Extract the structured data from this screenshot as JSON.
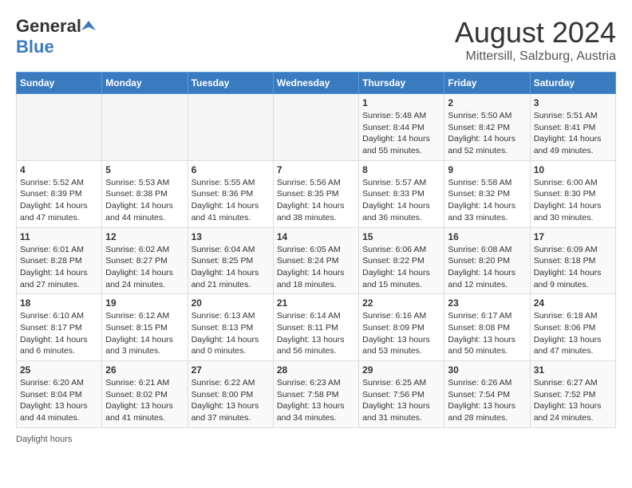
{
  "header": {
    "logo_general": "General",
    "logo_blue": "Blue",
    "month": "August 2024",
    "location": "Mittersill, Salzburg, Austria"
  },
  "weekdays": [
    "Sunday",
    "Monday",
    "Tuesday",
    "Wednesday",
    "Thursday",
    "Friday",
    "Saturday"
  ],
  "footer": {
    "note": "Daylight hours"
  },
  "weeks": [
    [
      {
        "day": "",
        "info": ""
      },
      {
        "day": "",
        "info": ""
      },
      {
        "day": "",
        "info": ""
      },
      {
        "day": "",
        "info": ""
      },
      {
        "day": "1",
        "info": "Sunrise: 5:48 AM\nSunset: 8:44 PM\nDaylight: 14 hours\nand 55 minutes."
      },
      {
        "day": "2",
        "info": "Sunrise: 5:50 AM\nSunset: 8:42 PM\nDaylight: 14 hours\nand 52 minutes."
      },
      {
        "day": "3",
        "info": "Sunrise: 5:51 AM\nSunset: 8:41 PM\nDaylight: 14 hours\nand 49 minutes."
      }
    ],
    [
      {
        "day": "4",
        "info": "Sunrise: 5:52 AM\nSunset: 8:39 PM\nDaylight: 14 hours\nand 47 minutes."
      },
      {
        "day": "5",
        "info": "Sunrise: 5:53 AM\nSunset: 8:38 PM\nDaylight: 14 hours\nand 44 minutes."
      },
      {
        "day": "6",
        "info": "Sunrise: 5:55 AM\nSunset: 8:36 PM\nDaylight: 14 hours\nand 41 minutes."
      },
      {
        "day": "7",
        "info": "Sunrise: 5:56 AM\nSunset: 8:35 PM\nDaylight: 14 hours\nand 38 minutes."
      },
      {
        "day": "8",
        "info": "Sunrise: 5:57 AM\nSunset: 8:33 PM\nDaylight: 14 hours\nand 36 minutes."
      },
      {
        "day": "9",
        "info": "Sunrise: 5:58 AM\nSunset: 8:32 PM\nDaylight: 14 hours\nand 33 minutes."
      },
      {
        "day": "10",
        "info": "Sunrise: 6:00 AM\nSunset: 8:30 PM\nDaylight: 14 hours\nand 30 minutes."
      }
    ],
    [
      {
        "day": "11",
        "info": "Sunrise: 6:01 AM\nSunset: 8:28 PM\nDaylight: 14 hours\nand 27 minutes."
      },
      {
        "day": "12",
        "info": "Sunrise: 6:02 AM\nSunset: 8:27 PM\nDaylight: 14 hours\nand 24 minutes."
      },
      {
        "day": "13",
        "info": "Sunrise: 6:04 AM\nSunset: 8:25 PM\nDaylight: 14 hours\nand 21 minutes."
      },
      {
        "day": "14",
        "info": "Sunrise: 6:05 AM\nSunset: 8:24 PM\nDaylight: 14 hours\nand 18 minutes."
      },
      {
        "day": "15",
        "info": "Sunrise: 6:06 AM\nSunset: 8:22 PM\nDaylight: 14 hours\nand 15 minutes."
      },
      {
        "day": "16",
        "info": "Sunrise: 6:08 AM\nSunset: 8:20 PM\nDaylight: 14 hours\nand 12 minutes."
      },
      {
        "day": "17",
        "info": "Sunrise: 6:09 AM\nSunset: 8:18 PM\nDaylight: 14 hours\nand 9 minutes."
      }
    ],
    [
      {
        "day": "18",
        "info": "Sunrise: 6:10 AM\nSunset: 8:17 PM\nDaylight: 14 hours\nand 6 minutes."
      },
      {
        "day": "19",
        "info": "Sunrise: 6:12 AM\nSunset: 8:15 PM\nDaylight: 14 hours\nand 3 minutes."
      },
      {
        "day": "20",
        "info": "Sunrise: 6:13 AM\nSunset: 8:13 PM\nDaylight: 14 hours\nand 0 minutes."
      },
      {
        "day": "21",
        "info": "Sunrise: 6:14 AM\nSunset: 8:11 PM\nDaylight: 13 hours\nand 56 minutes."
      },
      {
        "day": "22",
        "info": "Sunrise: 6:16 AM\nSunset: 8:09 PM\nDaylight: 13 hours\nand 53 minutes."
      },
      {
        "day": "23",
        "info": "Sunrise: 6:17 AM\nSunset: 8:08 PM\nDaylight: 13 hours\nand 50 minutes."
      },
      {
        "day": "24",
        "info": "Sunrise: 6:18 AM\nSunset: 8:06 PM\nDaylight: 13 hours\nand 47 minutes."
      }
    ],
    [
      {
        "day": "25",
        "info": "Sunrise: 6:20 AM\nSunset: 8:04 PM\nDaylight: 13 hours\nand 44 minutes."
      },
      {
        "day": "26",
        "info": "Sunrise: 6:21 AM\nSunset: 8:02 PM\nDaylight: 13 hours\nand 41 minutes."
      },
      {
        "day": "27",
        "info": "Sunrise: 6:22 AM\nSunset: 8:00 PM\nDaylight: 13 hours\nand 37 minutes."
      },
      {
        "day": "28",
        "info": "Sunrise: 6:23 AM\nSunset: 7:58 PM\nDaylight: 13 hours\nand 34 minutes."
      },
      {
        "day": "29",
        "info": "Sunrise: 6:25 AM\nSunset: 7:56 PM\nDaylight: 13 hours\nand 31 minutes."
      },
      {
        "day": "30",
        "info": "Sunrise: 6:26 AM\nSunset: 7:54 PM\nDaylight: 13 hours\nand 28 minutes."
      },
      {
        "day": "31",
        "info": "Sunrise: 6:27 AM\nSunset: 7:52 PM\nDaylight: 13 hours\nand 24 minutes."
      }
    ]
  ]
}
